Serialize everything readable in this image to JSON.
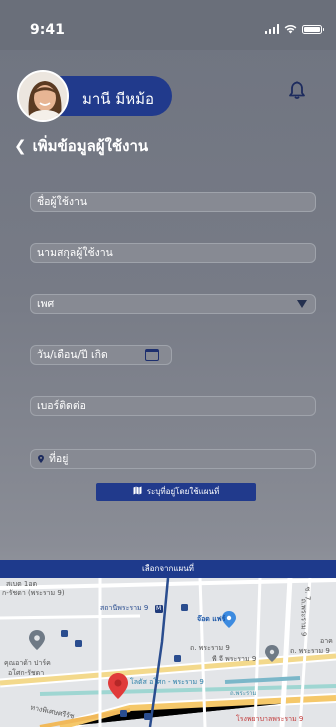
{
  "status_bar": {
    "time": "9:41"
  },
  "user": {
    "name": "มานี มีหม้อ"
  },
  "page": {
    "title": "เพิ่มข้อมูลผู้ใช้งาน"
  },
  "form": {
    "first_name_placeholder": "ชื่อผู้ใช้งาน",
    "last_name_placeholder": "นามสกุลผู้ใช้งาน",
    "gender_placeholder": "เพศ",
    "birthdate_placeholder": "วัน/เดือน/ปี เกิด",
    "phone_placeholder": "เบอร์ติดต่อ",
    "address_placeholder": "ที่อยู่",
    "map_locate_button": "ระบุที่อยู่โดยใช้แผนที่"
  },
  "map_bar": {
    "label": "เลือกจากแผนที่"
  },
  "map": {
    "labels": {
      "tl1": "สเบต 1อต",
      "tl2": "ก-รัชดา (พระราม 9)",
      "station": "สถานีพระราม 9",
      "m_badge": "M",
      "jod": "จ๊อด แฟร์",
      "rd1": "ถ. พระราม 9",
      "rd2": "พี จี พระราม 9",
      "rd3": "ถ. พระราม 9",
      "park1": "คุณอาด้า ปาร์ค",
      "park2": "อโศก-รัชดา",
      "lotte": "โลตัส อโศก - พระราม 9",
      "bot1": "ทางพิเศษศรีรัช",
      "bot2": "โรงพยาบาลพระราม 9",
      "side": "ซ. 7",
      "side2": "อาค",
      "side3": "ถ.พระราม 9",
      "side4": "ถ.พระราม"
    }
  }
}
